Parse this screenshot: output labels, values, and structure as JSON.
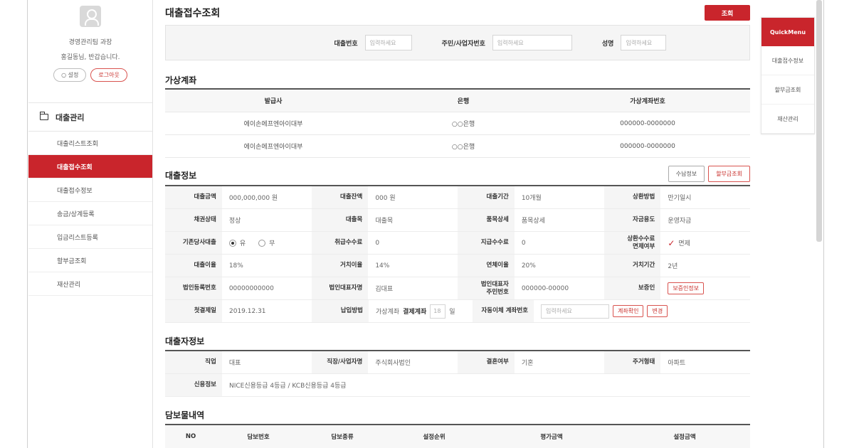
{
  "sidebar": {
    "profile_line1": "경영관리팀 과장",
    "profile_line2": "홍길동님, 반갑습니다.",
    "settings_label": "설정",
    "logout_label": "로그아웃",
    "menu_title": "대출관리",
    "items": [
      {
        "label": "대출리스트조회"
      },
      {
        "label": "대출접수조회"
      },
      {
        "label": "대출접수정보"
      },
      {
        "label": "송금/상계등록"
      },
      {
        "label": "입금리스트등록"
      },
      {
        "label": "할부금조회"
      },
      {
        "label": "재산관리"
      }
    ]
  },
  "main": {
    "title": "대출접수조회",
    "search_button": "조회",
    "search": {
      "loan_no_label": "대출번호",
      "loan_no_placeholder": "입력하세요",
      "id_label": "주민/사업자번호",
      "id_placeholder": "입력하세요",
      "name_label": "성명",
      "name_placeholder": "입력하세요"
    }
  },
  "virtual_account": {
    "title": "가상계좌",
    "headers": [
      "발급사",
      "은행",
      "가상계좌번호"
    ],
    "rows": [
      [
        "에이손에프엔아이대부",
        "○○은행",
        "000000-0000000"
      ],
      [
        "에이손에프엔아이대부",
        "○○은행",
        "000000-0000000"
      ]
    ]
  },
  "loan_info": {
    "title": "대출정보",
    "btn_receipt": "수납정보",
    "btn_installment": "할부금조회",
    "r1": {
      "l1": "대출금액",
      "v1": "000,000,000 원",
      "l2": "대출잔액",
      "v2": "000 원",
      "l3": "대출기간",
      "v3": "10개월",
      "l4": "상환방법",
      "v4": "만기일시"
    },
    "r2": {
      "l1": "채권상태",
      "v1": "정상",
      "l2": "대출목",
      "v2": "대출목",
      "l3": "품목상세",
      "v3": "품목상세",
      "l4": "자금용도",
      "v4": "운영자금"
    },
    "r3": {
      "l1": "기존당사대출",
      "opt_yes": "유",
      "opt_no": "무",
      "l2": "취급수수료",
      "v2": "0",
      "l3": "지급수수료",
      "v3": "0",
      "l4a": "상환수수료",
      "l4b": "면제여부",
      "v4": "면제"
    },
    "r4": {
      "l1": "대출이율",
      "v1": "18%",
      "l2": "거치이율",
      "v2": "14%",
      "l3": "연체이율",
      "v3": "20%",
      "l4": "거치기간",
      "v4": "2년"
    },
    "r5": {
      "l1": "법인등록번호",
      "v1": "00000000000",
      "l2": "법인대표자명",
      "v2": "김대표",
      "l3a": "법인대표자",
      "l3b": "주민번호",
      "v3": "000000-00000",
      "l4": "보증인",
      "v4": "보증인정보"
    },
    "r6": {
      "l1": "첫결제일",
      "v1": "2019.12.31",
      "l2": "납입방법",
      "v2a": "가상계좌",
      "v2b": "결제계좌",
      "v2c": "18",
      "v2d": "일",
      "l3": "자동이체 계좌번호",
      "placeholder": "입력하세요",
      "btn_confirm": "계좌확인",
      "btn_change": "변경"
    }
  },
  "borrower": {
    "title": "대출자정보",
    "r1": {
      "l1": "직업",
      "v1": "대표",
      "l2": "직장/사업자명",
      "v2": "주식회사법인",
      "l3": "결혼여부",
      "v3": "기혼",
      "l4": "주거형태",
      "v4": "아파트"
    },
    "r2": {
      "l1": "신용정보",
      "v1": "NICE신용등급 4등급 / KCB신용등급 4등급"
    }
  },
  "collateral": {
    "title": "담보물내역",
    "headers": [
      "NO",
      "담보번호",
      "담보종류",
      "설정순위",
      "평가금액",
      "설정금액"
    ]
  },
  "quick_menu": {
    "title": "QuickMenu",
    "items": [
      "대출접수정보",
      "할부금조회",
      "재산관리"
    ]
  }
}
